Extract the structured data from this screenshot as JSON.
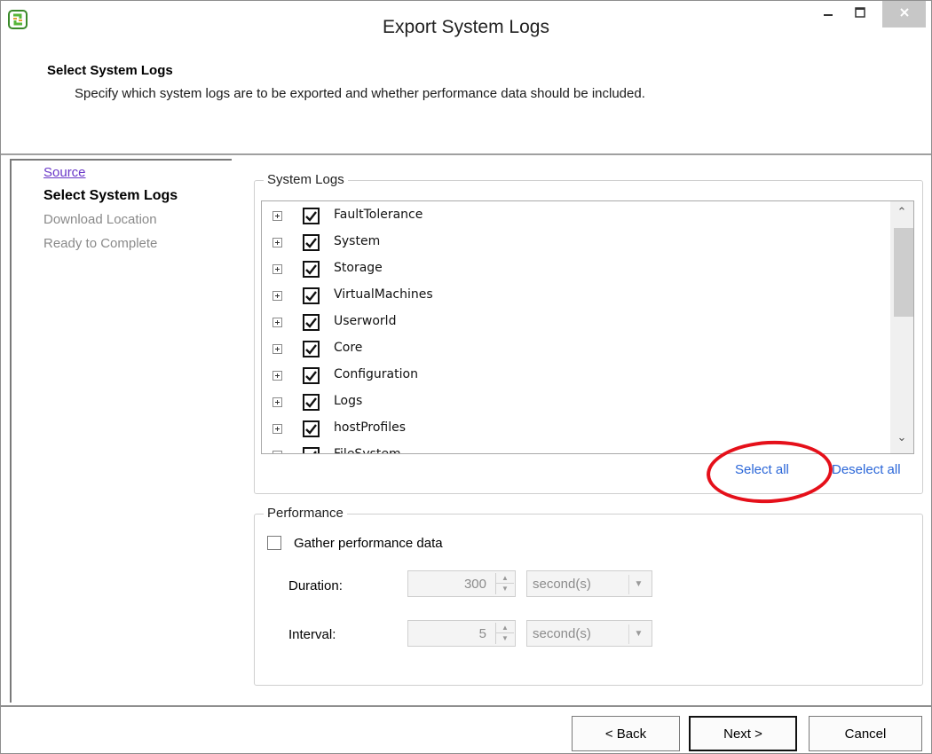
{
  "window": {
    "title": "Export System Logs",
    "icon": "vsphere-app-icon",
    "minimize_glyph": "–",
    "maximize_glyph": "□",
    "close_glyph": "✕"
  },
  "header": {
    "title": "Select System Logs",
    "description": "Specify which system logs are to be exported and whether performance data should be included."
  },
  "nav": {
    "items": [
      {
        "label": "Source",
        "state": "link"
      },
      {
        "label": "Select System Logs",
        "state": "active"
      },
      {
        "label": "Download Location",
        "state": "disabled"
      },
      {
        "label": "Ready to Complete",
        "state": "disabled"
      }
    ]
  },
  "system_logs": {
    "legend": "System Logs",
    "items": [
      {
        "label": "FaultTolerance",
        "checked": true
      },
      {
        "label": "System",
        "checked": true
      },
      {
        "label": "Storage",
        "checked": true
      },
      {
        "label": "VirtualMachines",
        "checked": true
      },
      {
        "label": "Userworld",
        "checked": true
      },
      {
        "label": "Core",
        "checked": true
      },
      {
        "label": "Configuration",
        "checked": true
      },
      {
        "label": "Logs",
        "checked": true
      },
      {
        "label": "hostProfiles",
        "checked": true
      },
      {
        "label": "FileSystem",
        "checked": true
      }
    ],
    "select_all": "Select all",
    "deselect_all": "Deselect all"
  },
  "performance": {
    "legend": "Performance",
    "gather_label": "Gather performance data",
    "gather_checked": false,
    "duration": {
      "label": "Duration:",
      "value": "300",
      "unit": "second(s)"
    },
    "interval": {
      "label": "Interval:",
      "value": "5",
      "unit": "second(s)"
    }
  },
  "footer": {
    "back": "< Back",
    "next": "Next >",
    "cancel": "Cancel"
  },
  "colors": {
    "link": "#2a66d8",
    "visited_link": "#6a38c8",
    "highlight_ellipse": "#e5101a",
    "disabled_text": "#8a8a8a"
  }
}
